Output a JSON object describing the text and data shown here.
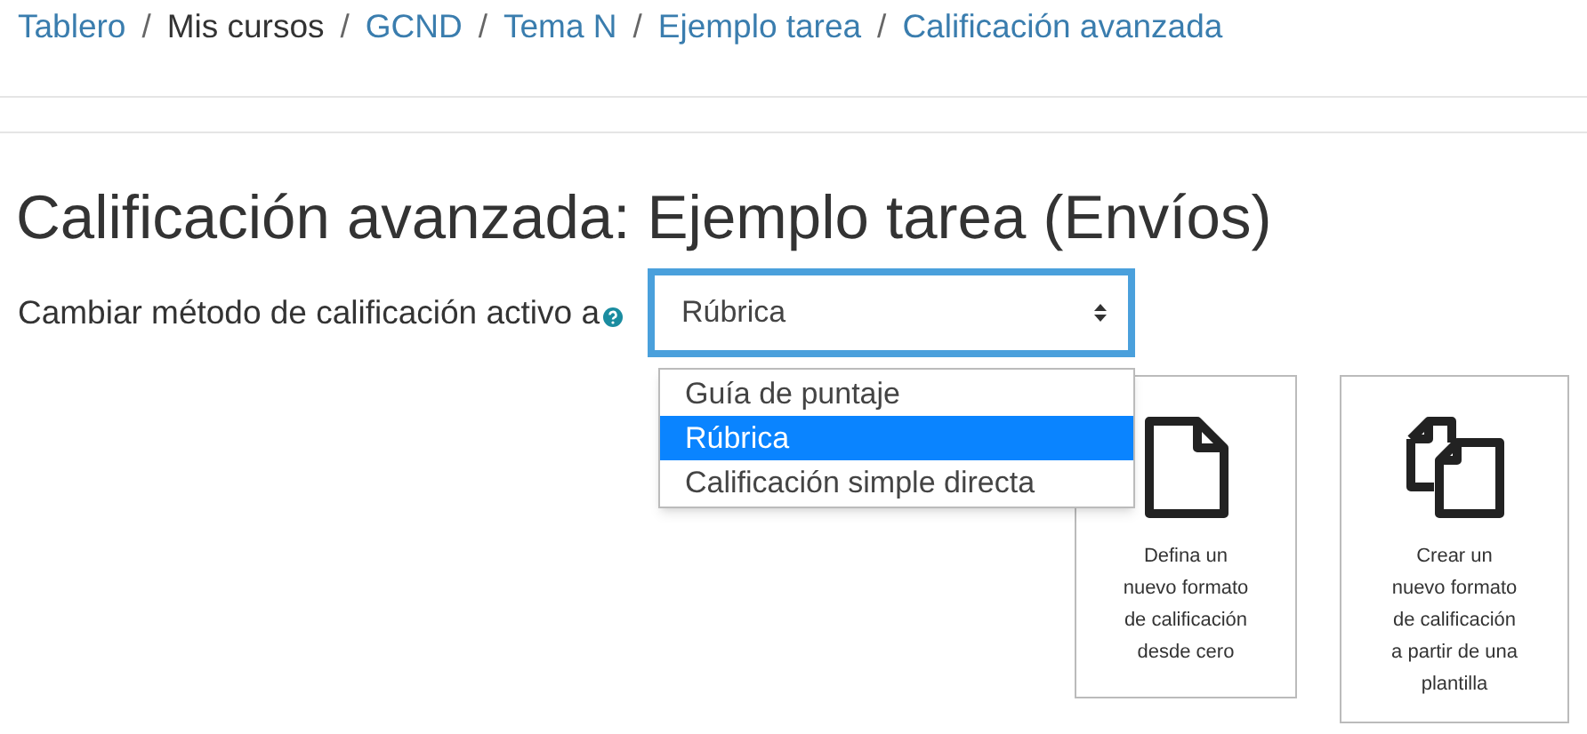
{
  "breadcrumb": [
    {
      "label": "Tablero",
      "link": true
    },
    {
      "label": "Mis cursos",
      "link": false
    },
    {
      "label": "GCND",
      "link": true
    },
    {
      "label": "Tema N",
      "link": true
    },
    {
      "label": "Ejemplo tarea",
      "link": true
    },
    {
      "label": "Calificación avanzada",
      "link": true
    }
  ],
  "breadcrumb_separator": "/",
  "heading": "Calificación avanzada: Ejemplo tarea (Envíos)",
  "method_label": "Cambiar método de calificación activo a",
  "method_select": {
    "value": "Rúbrica",
    "expanded": true,
    "options": [
      {
        "label": "Guía de puntaje",
        "selected": false
      },
      {
        "label": "Rúbrica",
        "selected": true
      },
      {
        "label": "Calificación simple directa",
        "selected": false
      }
    ]
  },
  "cards": [
    {
      "kind": "single",
      "text": "Defina un\nnuevo formato\nde calificación\ndesde cero"
    },
    {
      "kind": "double",
      "text": "Crear un\nnuevo formato\nde calificación\na partir de una\nplantilla"
    }
  ]
}
